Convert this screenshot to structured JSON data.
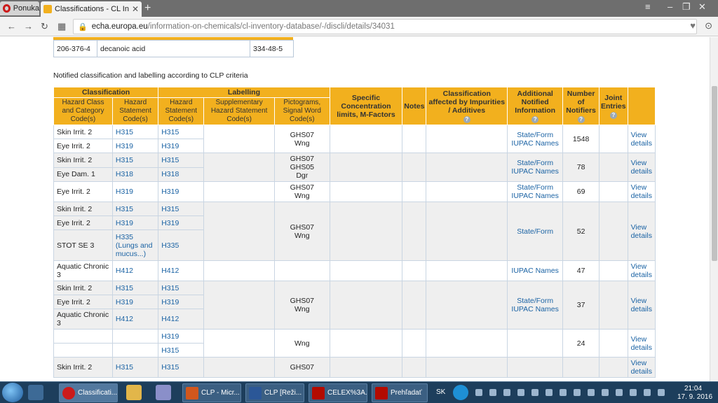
{
  "browser": {
    "opera_tab_label": "Ponuka",
    "active_tab_title": "Classifications - CL Invento",
    "url_host": "echa.europa.eu",
    "url_path": "/information-on-chemicals/cl-inventory-database/-/discli/details/34031"
  },
  "substance": {
    "ec_number": "206-376-4",
    "name": "decanoic acid",
    "cas_number": "334-48-5"
  },
  "caption": "Notified classification and labelling according to CLP criteria",
  "headers": {
    "classification": "Classification",
    "labelling": "Labelling",
    "hazard_class": "Hazard Class and Category Code(s)",
    "hazard_statement_c": "Hazard Statement Code(s)",
    "hazard_statement_l": "Hazard Statement Code(s)",
    "supplementary": "Supplementary Hazard Statement Code(s)",
    "pictograms": "Pictograms, Signal Word Code(s)",
    "specific_conc": "Specific Concentration limits, M-Factors",
    "notes": "Notes",
    "impurities": "Classification affected by Impurities / Additives",
    "additional": "Additional Notified Information",
    "notifiers": "Number of Notifiers",
    "joint": "Joint Entries",
    "help_glyph": "?"
  },
  "groups": [
    {
      "rows": [
        {
          "cls": "Skin Irrit. 2",
          "hc": "H315",
          "hl": "H315"
        },
        {
          "cls": "Eye Irrit. 2",
          "hc": "H319",
          "hl": "H319"
        }
      ],
      "pict": "GHS07\nWng",
      "info": "State/Form\nIUPAC Names",
      "notifiers": "1548",
      "view": "View details"
    },
    {
      "rows": [
        {
          "cls": "Skin Irrit. 2",
          "hc": "H315",
          "hl": "H315"
        },
        {
          "cls": "Eye Dam. 1",
          "hc": "H318",
          "hl": "H318"
        }
      ],
      "pict": "GHS07\nGHS05\nDgr",
      "info": "State/Form\nIUPAC Names",
      "notifiers": "78",
      "view": "View details"
    },
    {
      "rows": [
        {
          "cls": "Eye Irrit. 2",
          "hc": "H319",
          "hl": "H319"
        }
      ],
      "pict": "GHS07\nWng",
      "info": "State/Form\nIUPAC Names",
      "notifiers": "69",
      "view": "View details"
    },
    {
      "rows": [
        {
          "cls": "Skin Irrit. 2",
          "hc": "H315",
          "hl": "H315"
        },
        {
          "cls": "Eye Irrit. 2",
          "hc": "H319",
          "hl": "H319"
        },
        {
          "cls": "STOT SE 3",
          "hc": "H335 (Lungs and mucus...)",
          "hl": "H335"
        }
      ],
      "pict": "GHS07\nWng",
      "info": "State/Form",
      "notifiers": "52",
      "view": "View details"
    },
    {
      "rows": [
        {
          "cls": "Aquatic Chronic 3",
          "hc": "H412",
          "hl": "H412"
        }
      ],
      "pict": "",
      "info": "IUPAC Names",
      "notifiers": "47",
      "view": "View details"
    },
    {
      "rows": [
        {
          "cls": "Skin Irrit. 2",
          "hc": "H315",
          "hl": "H315"
        },
        {
          "cls": "Eye Irrit. 2",
          "hc": "H319",
          "hl": "H319"
        },
        {
          "cls": "Aquatic Chronic 3",
          "hc": "H412",
          "hl": "H412"
        }
      ],
      "pict": "GHS07\nWng",
      "info": "State/Form\nIUPAC Names",
      "notifiers": "37",
      "view": "View details"
    },
    {
      "rows": [
        {
          "cls": "",
          "hc": "",
          "hl": "H319"
        },
        {
          "cls": "",
          "hc": "",
          "hl": "H315"
        }
      ],
      "pict": "Wng",
      "info": "",
      "notifiers": "24",
      "view": "View details"
    },
    {
      "rows": [
        {
          "cls": "Skin Irrit. 2",
          "hc": "H315",
          "hl": "H315"
        }
      ],
      "pict": "GHS07",
      "info": "",
      "notifiers": "",
      "view": "View details"
    }
  ],
  "taskbar": {
    "items": [
      "Classificati...",
      "CLP - Micr...",
      "CLP [Reži...",
      "CELEX%3A...",
      "Prehľadať"
    ],
    "lang": "SK",
    "time": "21:04",
    "date": "17. 9. 2016"
  }
}
